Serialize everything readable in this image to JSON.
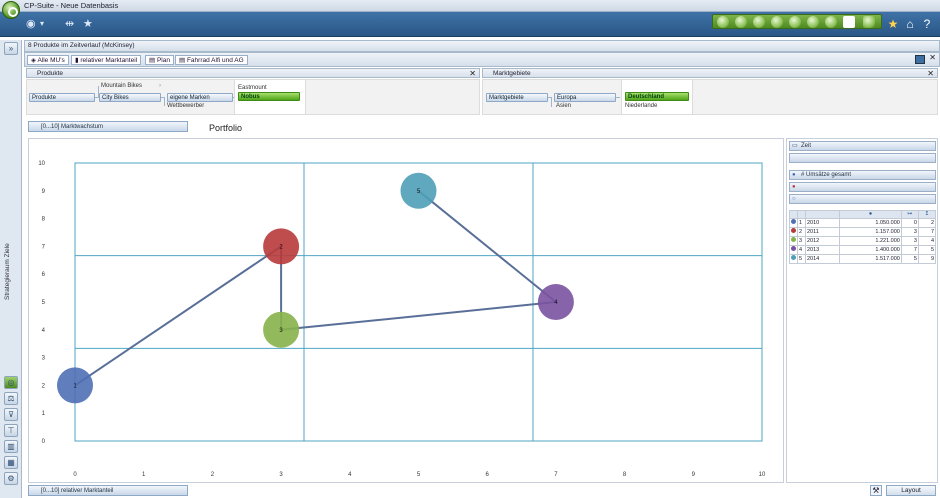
{
  "window": {
    "title": "CP-Suite - Neue Datenbasis"
  },
  "toolbar": {
    "star_icon": "star-icon",
    "home_icon": "home-icon",
    "help_icon": "help-icon"
  },
  "leftrail": {
    "label": "Strategieraum Ziele",
    "expand": "»"
  },
  "module": {
    "header": "8 Produkte im Zeitverlauf (McKinsey)"
  },
  "tabs": [
    {
      "label": "Alle MU's"
    },
    {
      "label": "relativer Marktanteil"
    },
    {
      "label": "Plan"
    },
    {
      "label": "Fahrrad Alfi und AG"
    }
  ],
  "produkte": {
    "header": "Produkte",
    "root": "Produkte",
    "level1": [
      "Mountain Bikes",
      "City Bikes"
    ],
    "level2": [
      "eigene Marken",
      "Wettbewerber"
    ],
    "level3": [
      "Eastmount",
      "Nobus"
    ]
  },
  "marktgebiete": {
    "header": "Marktgebiete",
    "root": "Marktgebiete",
    "level1": [
      "Europa",
      "Asien"
    ],
    "level2": [
      "Deutschland",
      "Niederlande"
    ]
  },
  "yaxis_field": "[0...10] Marktwachstum",
  "xaxis_field": "[0...10] relativer Marktanteil",
  "chart_title": "Portfolio",
  "chart_data": {
    "type": "scatter",
    "title": "Portfolio",
    "xlabel": "[0...10] relativer Marktanteil",
    "ylabel": "[0...10] Marktwachstum",
    "xlim": [
      0,
      10
    ],
    "ylim": [
      0,
      10
    ],
    "xticks": [
      0,
      1,
      2,
      3,
      4,
      5,
      6,
      7,
      8,
      9,
      10
    ],
    "yticks": [
      0,
      1,
      2,
      3,
      4,
      5,
      6,
      7,
      8,
      9,
      10
    ],
    "grid": "3x3 quadrants",
    "connected_path": true,
    "points": [
      {
        "label": "1",
        "x": 0,
        "y": 2,
        "color": "#4f6fb5"
      },
      {
        "label": "2",
        "x": 3,
        "y": 7,
        "color": "#b83a3a"
      },
      {
        "label": "3",
        "x": 3,
        "y": 4,
        "color": "#86b34a"
      },
      {
        "label": "4",
        "x": 7,
        "y": 5,
        "color": "#7a52a0"
      },
      {
        "label": "5",
        "x": 5,
        "y": 9,
        "color": "#4e9fb7"
      }
    ]
  },
  "rightpanel": {
    "fields": [
      {
        "label": "Zeit"
      },
      {
        "label": ""
      },
      {
        "label": "# Umsätze gesamt"
      },
      {
        "label": ""
      },
      {
        "label": ""
      }
    ],
    "table": {
      "rows": [
        {
          "n": "1",
          "year": "2010",
          "value": "1.050.000",
          "a": "0",
          "b": "2",
          "color": "#4f6fb5"
        },
        {
          "n": "2",
          "year": "2011",
          "value": "1.157.000",
          "a": "3",
          "b": "7",
          "color": "#b83a3a"
        },
        {
          "n": "3",
          "year": "2012",
          "value": "1.221.000",
          "a": "3",
          "b": "4",
          "color": "#86b34a"
        },
        {
          "n": "4",
          "year": "2013",
          "value": "1.400.000",
          "a": "7",
          "b": "5",
          "color": "#7a52a0"
        },
        {
          "n": "5",
          "year": "2014",
          "value": "1.517.000",
          "a": "5",
          "b": "9",
          "color": "#4e9fb7"
        }
      ]
    }
  },
  "layout_button": "Layout"
}
